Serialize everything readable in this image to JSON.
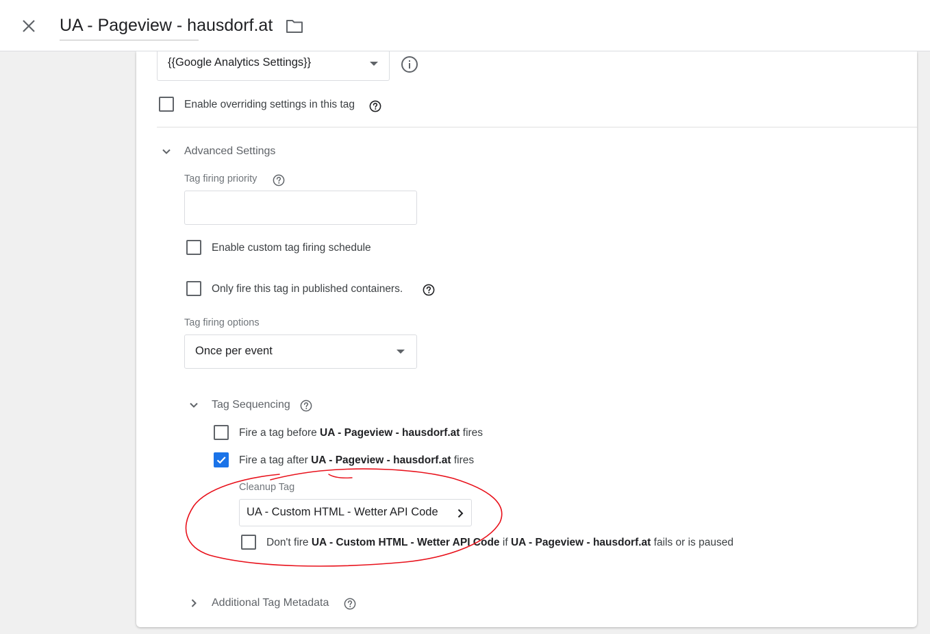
{
  "header": {
    "title": "UA - Pageview - hausdorf.at"
  },
  "settings": {
    "variable_value": "{{Google Analytics Settings}}",
    "override_label": "Enable overriding settings in this tag",
    "override_checked": false
  },
  "advanced": {
    "title": "Advanced Settings",
    "priority_label": "Tag firing priority",
    "priority_value": "",
    "schedule_label": "Enable custom tag firing schedule",
    "schedule_checked": false,
    "published_label": "Only fire this tag in published containers.",
    "published_checked": false,
    "options_label": "Tag firing options",
    "options_value": "Once per event"
  },
  "sequencing": {
    "title": "Tag Sequencing",
    "before": {
      "prefix": "Fire a tag before ",
      "tag": "UA - Pageview - hausdorf.at",
      "suffix": " fires",
      "checked": false
    },
    "after": {
      "prefix": "Fire a tag after ",
      "tag": "UA - Pageview - hausdorf.at",
      "suffix": " fires",
      "checked": true
    },
    "cleanup_label": "Cleanup Tag",
    "cleanup_value": "UA - Custom HTML - Wetter API Code",
    "dontfire": {
      "prefix": "Don't fire ",
      "tag1": "UA - Custom HTML - Wetter API Code",
      "middle": " if ",
      "tag2": "UA - Pageview - hausdorf.at",
      "suffix": " fails or is paused",
      "checked": false
    }
  },
  "metadata": {
    "title": "Additional Tag Metadata"
  },
  "colors": {
    "accent": "#1a73e8",
    "annotation": "#e8101a"
  }
}
